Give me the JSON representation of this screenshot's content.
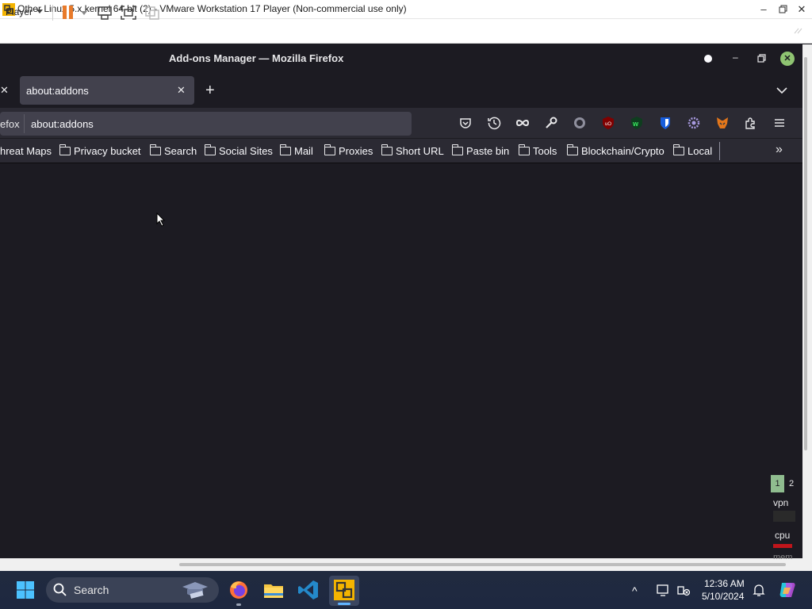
{
  "vmware": {
    "window_title": "Other Linux 5.x kernel 64-bit (2) - VMware Workstation 17 Player (Non-commercial use only)",
    "player_menu_label": "Player"
  },
  "firefox": {
    "window_title": "Add-ons Manager — Mozilla Firefox",
    "tab_label": "about:addons",
    "url_identity": "efox",
    "url_value": "about:addons",
    "toolbar_icons": [
      "pocket-icon",
      "history-icon",
      "infinity-icon",
      "wrench-icon",
      "circle-extension-icon",
      "ublock-icon",
      "wappalyzer-icon",
      "bitwarden-icon",
      "gear-extension-icon",
      "metamask-icon",
      "extensions-icon",
      "menu-icon"
    ],
    "bookmarks": [
      "hreat Maps",
      "Privacy bucket",
      "Search",
      "Social Sites",
      "Mail",
      "Proxies",
      "Short URL",
      "Paste bin",
      "Tools",
      "Blockchain/Crypto",
      "Local"
    ]
  },
  "widget": {
    "ws1": "1",
    "ws2": "2",
    "vpn": "vpn",
    "cpu": "cpu",
    "mem": "mem"
  },
  "taskbar": {
    "search_label": "Search",
    "time": "12:36 AM",
    "date": "5/10/2024"
  },
  "colors": {
    "accent": "#e87a2a",
    "firefox_bg": "#1c1b22",
    "workspace_active": "#8fbc8f",
    "cpu_bar": "#c0151b"
  }
}
